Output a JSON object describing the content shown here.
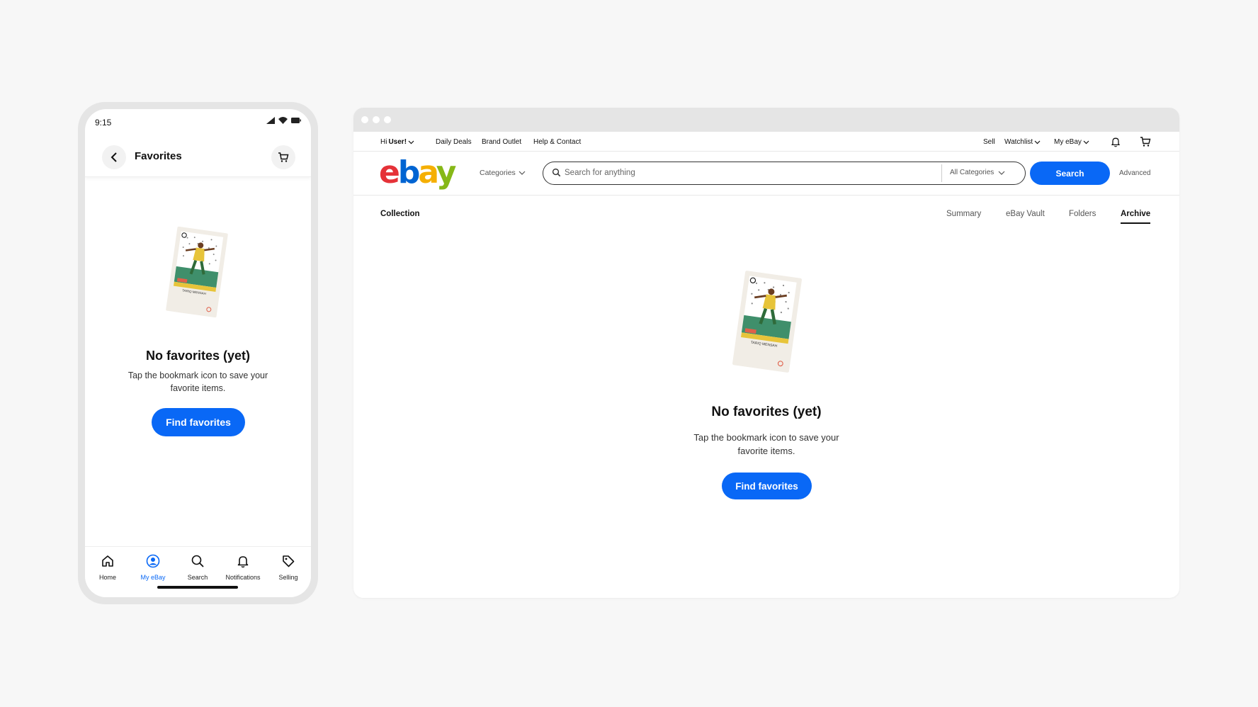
{
  "colors": {
    "accent": "#0968f6",
    "phone_frame": "#e5e5e5",
    "background": "#f7f7f7"
  },
  "phone": {
    "status_time": "9:15",
    "header": {
      "title": "Favorites",
      "back_icon": "chevron-left-icon",
      "cart_icon": "cart-icon"
    },
    "empty_state": {
      "title": "No favorites (yet)",
      "description": "Tap the bookmark icon to save your favorite items.",
      "button_label": "Find favorites"
    },
    "tabbar": [
      {
        "label": "Home",
        "icon": "home-icon",
        "active": false
      },
      {
        "label": "My eBay",
        "icon": "user-icon",
        "active": true
      },
      {
        "label": "Search",
        "icon": "search-icon",
        "active": false
      },
      {
        "label": "Notifications",
        "icon": "bell-icon",
        "active": false
      },
      {
        "label": "Selling",
        "icon": "tag-icon",
        "active": false
      }
    ]
  },
  "browser": {
    "topnav": {
      "greeting_prefix": "Hi ",
      "greeting_user": "User!",
      "links": [
        "Daily Deals",
        "Brand Outlet",
        "Help & Contact"
      ],
      "sell": "Sell",
      "watchlist": "Watchlist",
      "my_ebay": "My eBay"
    },
    "header": {
      "logo": {
        "e": "e",
        "b": "b",
        "a": "a",
        "y": "y"
      },
      "categories_label": "Categories",
      "search_placeholder": "Search for anything",
      "all_categories": "All Categories",
      "search_button": "Search",
      "advanced": "Advanced"
    },
    "subnav": {
      "title": "Collection",
      "tabs": [
        "Summary",
        "eBay Vault",
        "Folders",
        "Archive"
      ],
      "active_tab": "Archive"
    },
    "empty_state": {
      "title": "No favorites (yet)",
      "description": "Tap the bookmark icon to save your favorite items.",
      "button_label": "Find favorites",
      "card_name": "TARIQ MENSAH"
    }
  }
}
